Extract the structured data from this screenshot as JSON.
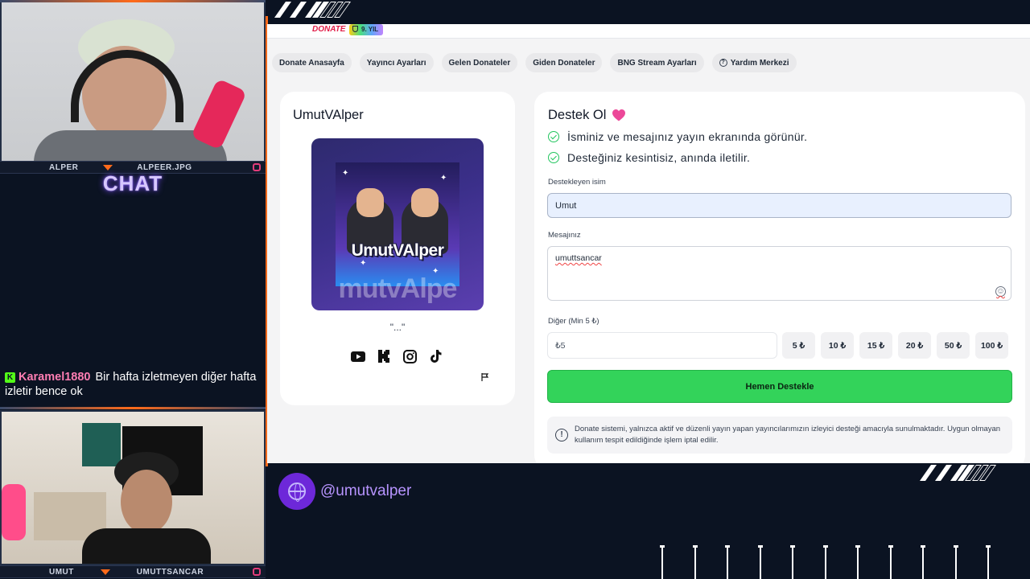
{
  "stream": {
    "cam_top_left_tag": "ALPER",
    "cam_top_right_tag": "ALPEER.JPG",
    "chat_title": "CHAT",
    "chat_message": {
      "user": "Karamel1880",
      "text": "Bir hafta izletmeyen diğer hafta izletir bence ok"
    },
    "cam_bottom_left_tag": "UMUT",
    "cam_bottom_right_tag": "UMUTTSANCAR",
    "handle": "@umutvalper"
  },
  "site": {
    "logo": "DONATE",
    "year_badge": "9. YIL",
    "tabs": [
      "Donate Anasayfa",
      "Yayıncı Ayarları",
      "Gelen Donateler",
      "Giden Donateler",
      "BNG Stream Ayarları",
      "Yardım Merkezi"
    ]
  },
  "profile": {
    "name": "UmutVAlper",
    "avatar_text": "UmutVAlper",
    "avatar_watermark": "mutvAlpe",
    "quote": "\"...\"",
    "socials": [
      "youtube-icon",
      "kick-icon",
      "instagram-icon",
      "tiktok-icon"
    ]
  },
  "donation": {
    "title": "Destek Ol",
    "benefits": [
      "İsminiz ve mesajınız yayın ekranında görünür.",
      "Desteğiniz kesintisiz, anında iletilir."
    ],
    "name_label": "Destekleyen isim",
    "name_value": "Umut",
    "message_label": "Mesajınız",
    "message_value": "umuttsancar",
    "amount_label": "Diğer (Min 5 ₺)",
    "amount_value": "₺5",
    "presets": [
      "5 ₺",
      "10 ₺",
      "15 ₺",
      "20 ₺",
      "50 ₺",
      "100 ₺"
    ],
    "submit_label": "Hemen Destekle",
    "notice": "Donate sistemi, yalnızca aktif ve düzenli yayın yapan yayıncılarımızın izleyici desteği amacıyla sunulmaktadır. Uygun olmayan kullanım tespit edildiğinde işlem iptal edilir."
  },
  "colors": {
    "accent_green": "#33d35a",
    "brand_purple": "#6d28d9",
    "heart": "#ec4899",
    "logo_red": "#e11d48"
  }
}
